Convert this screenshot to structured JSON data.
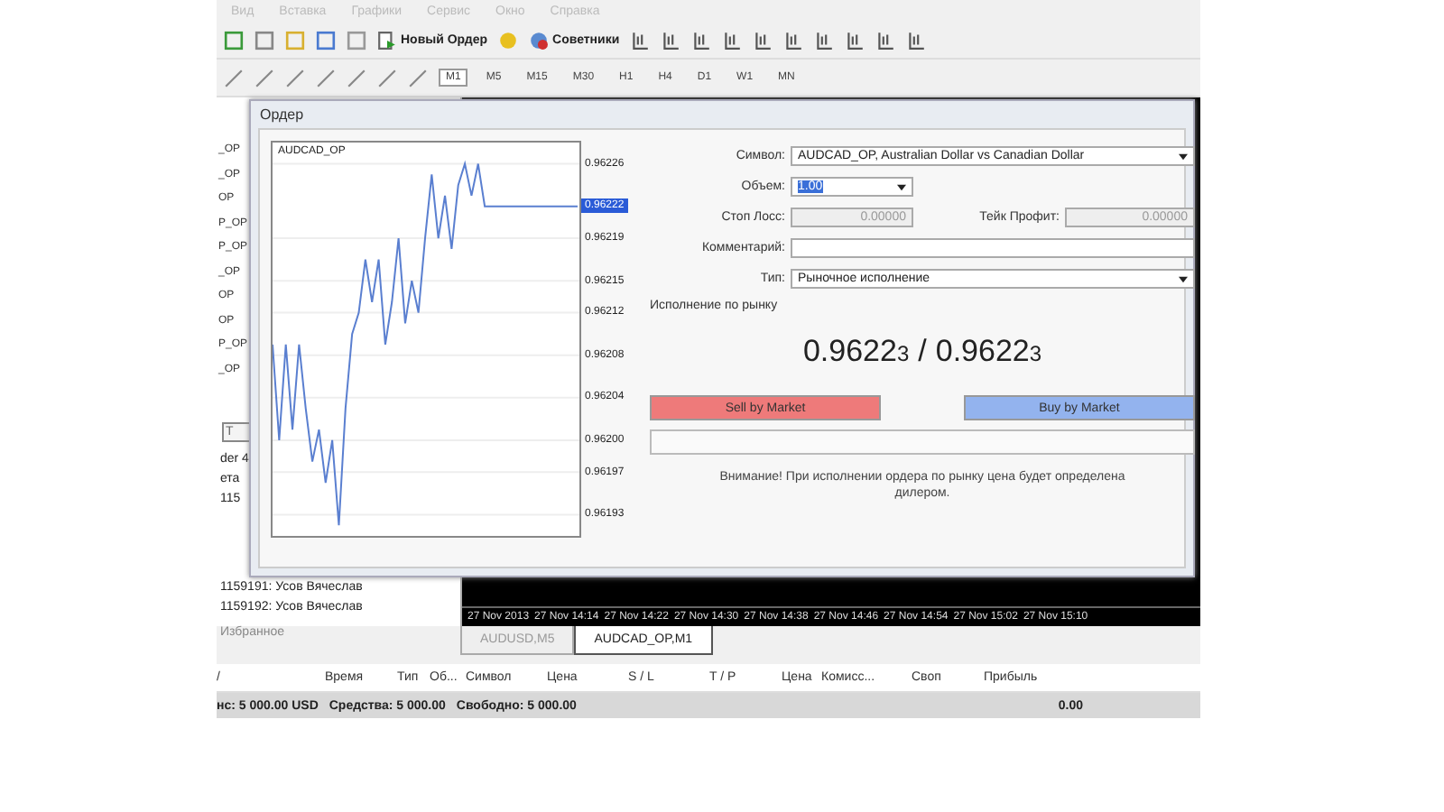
{
  "menu": [
    "Вид",
    "Вставка",
    "Графики",
    "Сервис",
    "Окно",
    "Справка"
  ],
  "toolbar": {
    "new_order": "Новый Ордер",
    "experts": "Советники"
  },
  "timeframes": [
    {
      "label": "M1",
      "selected": true
    },
    {
      "label": "M5",
      "selected": false
    },
    {
      "label": "M15",
      "selected": false
    },
    {
      "label": "M30",
      "selected": false
    },
    {
      "label": "H1",
      "selected": false
    },
    {
      "label": "H4",
      "selected": false
    },
    {
      "label": "D1",
      "selected": false
    },
    {
      "label": "W1",
      "selected": false
    },
    {
      "label": "MN",
      "selected": false
    }
  ],
  "market_watch": [
    "_OP",
    "_OP",
    "OP",
    "P_OP",
    "P_OP",
    "_OP",
    "OP",
    "OP",
    "P_OP",
    "_OP"
  ],
  "navigator": {
    "tab": "T",
    "lines": [
      "der 4",
      "ета",
      "115",
      "1159191: Усов Вячеслав",
      "1159192: Усов Вячеслав"
    ],
    "bottom_tab": "Избранное"
  },
  "dialog": {
    "title": "Ордер",
    "current_price": "0.96222",
    "chart_data": {
      "type": "line",
      "grid": true,
      "ylim": [
        0.96191,
        0.96228
      ],
      "yticks": [
        {
          "value": 0.96226,
          "label": "0.96226"
        },
        {
          "value": 0.96219,
          "label": "0.96219"
        },
        {
          "value": 0.96215,
          "label": "0.96215"
        },
        {
          "value": 0.96212,
          "label": "0.96212"
        },
        {
          "value": 0.96208,
          "label": "0.96208"
        },
        {
          "value": 0.96204,
          "label": "0.96204"
        },
        {
          "value": 0.962,
          "label": "0.96200"
        },
        {
          "value": 0.96197,
          "label": "0.96197"
        },
        {
          "value": 0.96193,
          "label": "0.96193"
        }
      ],
      "series": [
        {
          "name": "AUDCAD_OP",
          "color": "#5a7fd0",
          "values": [
            0.96209,
            0.962,
            0.96209,
            0.96201,
            0.96209,
            0.96203,
            0.96198,
            0.96201,
            0.96196,
            0.962,
            0.96192,
            0.96203,
            0.9621,
            0.96212,
            0.96217,
            0.96213,
            0.96217,
            0.96209,
            0.96213,
            0.96219,
            0.96211,
            0.96215,
            0.96212,
            0.96219,
            0.96225,
            0.96219,
            0.96223,
            0.96218,
            0.96224,
            0.96226,
            0.96223,
            0.96226,
            0.96222,
            0.96222,
            0.96222,
            0.96222,
            0.96222,
            0.96222,
            0.96222,
            0.96222,
            0.96222,
            0.96222,
            0.96222,
            0.96222,
            0.96222,
            0.96222,
            0.96222
          ]
        }
      ]
    },
    "progress": {
      "level": 0
    },
    "symbol": {
      "label": "Символ:",
      "value": "AUDCAD_OP, Australian Dollar vs Canadian Dollar"
    },
    "volume": {
      "label": "Объем:",
      "value": "1.00"
    },
    "stop_loss": {
      "label": "Стоп Лосс:",
      "value": "0.00000",
      "disabled": true
    },
    "take_profit": {
      "label": "Тейк Профит:",
      "value": "0.00000",
      "disabled": true
    },
    "comment": {
      "label": "Комментарий:"
    },
    "type": {
      "label": "Тип:",
      "value": "Рыночное исполнение"
    },
    "execution": "Исполнение по рынку",
    "bid": {
      "main": "0.9622",
      "pip": "3"
    },
    "separator": "/",
    "ask": {
      "main": "0.9622",
      "pip": "3"
    },
    "sell": "Sell by Market",
    "buy": "Buy by Market",
    "warning": "Внимание! При исполнении ордера по рынку цена будет определена дилером."
  },
  "time_axis": [
    "27 Nov 2013",
    "27 Nov 14:14",
    "27 Nov 14:22",
    "27 Nov 14:30",
    "27 Nov 14:38",
    "27 Nov 14:46",
    "27 Nov 14:54",
    "27 Nov 15:02",
    "27 Nov 15:10"
  ],
  "chart_tabs": [
    {
      "label": "AUDUSD,M5",
      "selected": false
    },
    {
      "label": "AUDCAD_OP,M1",
      "selected": true
    }
  ],
  "terminal": {
    "columns": [
      "/",
      "Время",
      "Тип",
      "Об...",
      "Символ",
      "Цена",
      "S / L",
      "T / P",
      "Цена",
      "Комисс...",
      "Своп",
      "Прибыль"
    ],
    "balance": "нс: 5 000.00 USD",
    "equity": "Средства: 5 000.00",
    "free": "Свободно: 5 000.00",
    "profit": "0.00"
  }
}
